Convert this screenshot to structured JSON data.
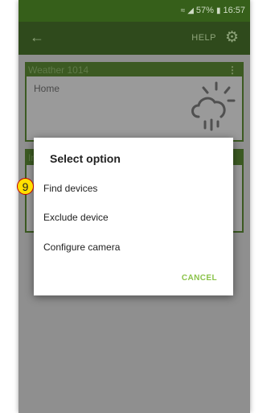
{
  "status_bar": {
    "battery": "57%",
    "time": "16:57",
    "icons": [
      "wifi-icon",
      "signal-icon",
      "battery-icon"
    ]
  },
  "app_bar": {
    "back_icon": "back-arrow-icon",
    "help_label": "HELP",
    "settings_icon": "gear-icon"
  },
  "cards": {
    "weather": {
      "title": "Weather 1014",
      "subtitle": "Home",
      "icon": "weather-cloud-sun-icon"
    },
    "second": {
      "title_visible": "In"
    }
  },
  "dialog": {
    "title": "Select option",
    "options": [
      {
        "label": "Find devices"
      },
      {
        "label": "Exclude device"
      },
      {
        "label": "Configure camera"
      }
    ],
    "cancel_label": "CANCEL"
  },
  "annotation": {
    "step_number": "9"
  },
  "colors": {
    "dialog_accent": "#8bc34a",
    "app_bar": "#2f4a1c",
    "status_bar": "#365f1a",
    "card_header": "#3c5a22",
    "badge_fill": "#ffe000",
    "badge_border": "#c00000"
  }
}
